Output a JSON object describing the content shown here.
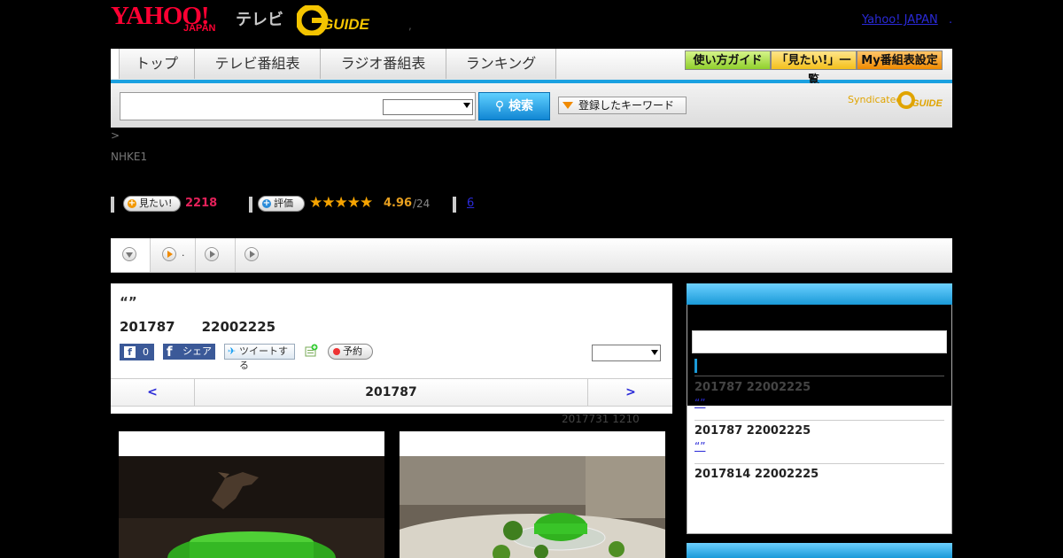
{
  "header": {
    "logo_yahoo": "YAHOO!",
    "logo_japan": "JAPAN",
    "logo_tv": "テレビ",
    "logo_guide": "GUIDE",
    "yahoo_japan_link": "Yahoo! JAPAN",
    "dot": ".",
    "comma": ","
  },
  "nav": {
    "tabs": [
      "トップ",
      "テレビ番組表",
      "ラジオ番組表",
      "ランキング"
    ],
    "tools": [
      "使い方ガイド",
      "「見たい!」一覧",
      "My番組表設定"
    ]
  },
  "search": {
    "button_label": "検索",
    "keyword_label": "登録したキーワード",
    "syndicated": "Syndicated"
  },
  "program": {
    "breadcrumb": ">",
    "channel": "NHKE1",
    "want_label": "見たい!",
    "want_count": "2218",
    "rate_label": "評価",
    "stars": "★★★★★",
    "score": "4.96",
    "score_of": "/24",
    "review_count": "6",
    "title": "“”",
    "datetime": "201787　　22002225",
    "fb_count": "0",
    "fb_share": "シェア",
    "tweet": "ツイートする",
    "reserve": "予約"
  },
  "tabs_row": {
    "second_label": "."
  },
  "date_nav": {
    "prev": "<",
    "current": "201787",
    "next": ">"
  },
  "updated": "2017731  1210",
  "sidebar": {
    "items": [
      {
        "date": "201787  22002225",
        "link": "“”"
      },
      {
        "date": "201787  22002225",
        "link": "“”"
      },
      {
        "date": "2017814  22002225",
        "link": ""
      }
    ]
  },
  "colors": {
    "accent_blue": "#1aa0e0",
    "yahoo_red": "#ff0033",
    "want_pink": "#e4215a",
    "star_orange": "#f5a300"
  }
}
